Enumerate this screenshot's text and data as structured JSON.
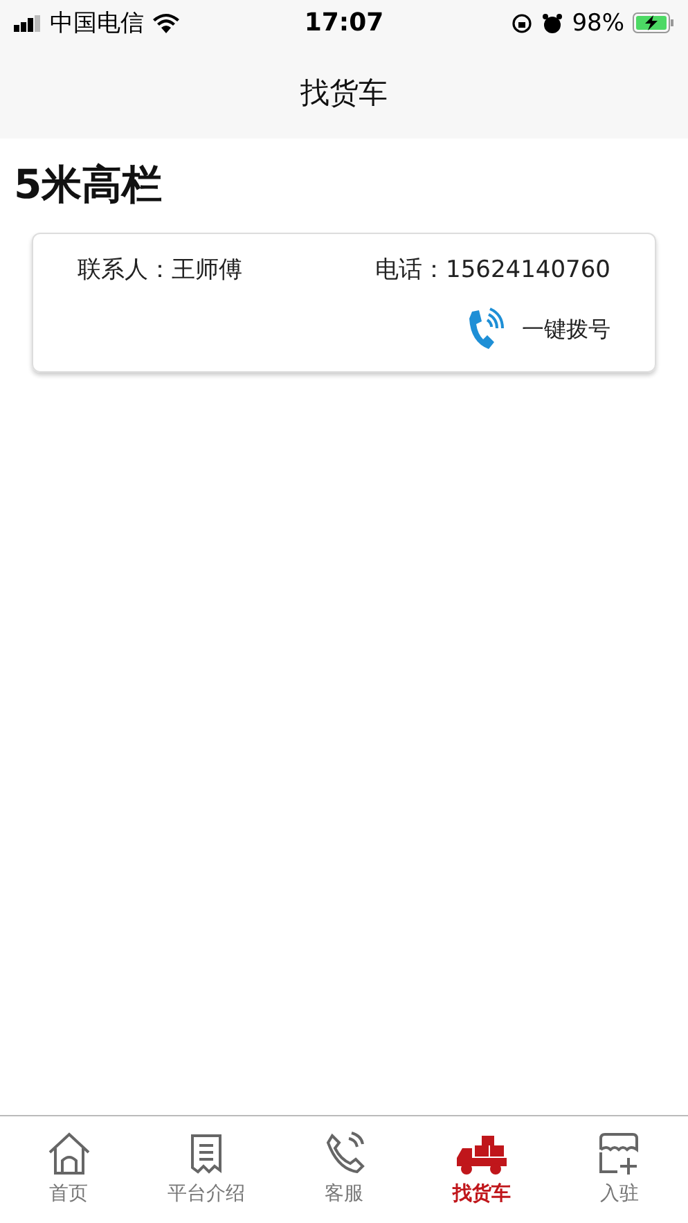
{
  "status_bar": {
    "carrier": "中国电信",
    "time": "17:07",
    "battery": "98%"
  },
  "nav_bar": {
    "title": "找货车"
  },
  "listing": {
    "title": "5米高栏",
    "contact_label": "联系人：",
    "contact_name": "王师傅",
    "phone_label": "电话：",
    "phone": "15624140760",
    "dial_label": "一键拨号"
  },
  "tabs": [
    {
      "kind": "home",
      "label": "首页",
      "selected": false
    },
    {
      "kind": "intro",
      "label": "平台介绍",
      "selected": false
    },
    {
      "kind": "service",
      "label": "客服",
      "selected": false
    },
    {
      "kind": "truck",
      "label": "找货车",
      "selected": true
    },
    {
      "kind": "join",
      "label": "入驻",
      "selected": false
    }
  ]
}
